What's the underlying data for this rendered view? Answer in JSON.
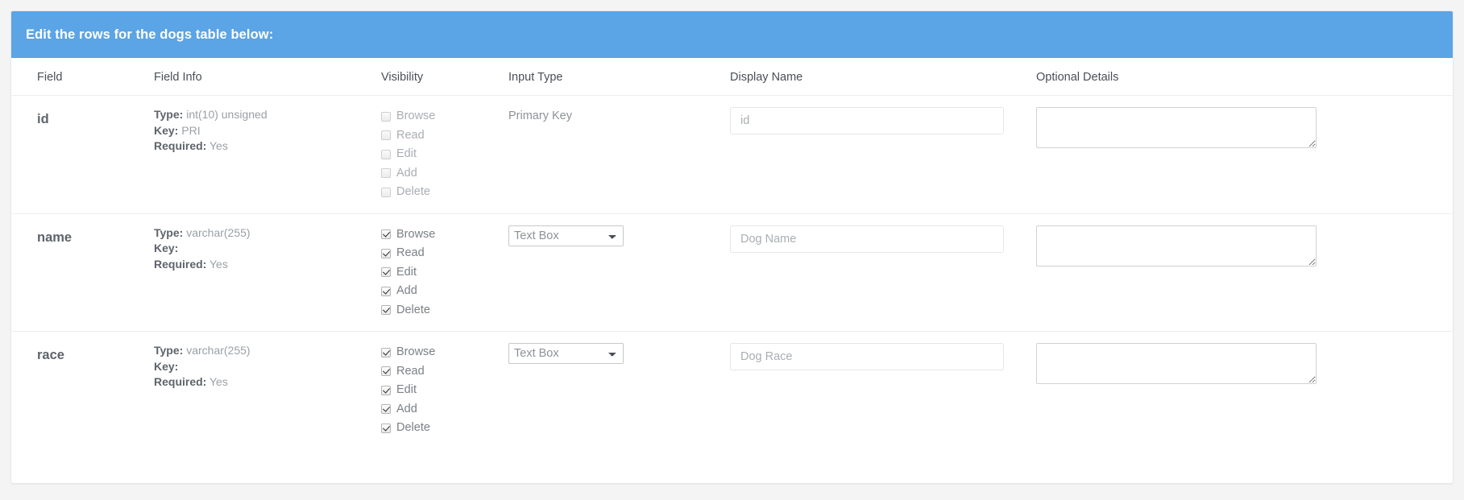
{
  "header": {
    "title": "Edit the rows for the dogs table below:",
    "accent_color": "#5ba4e5"
  },
  "table": {
    "columns": [
      {
        "key": "field",
        "label": "Field"
      },
      {
        "key": "field_info",
        "label": "Field Info"
      },
      {
        "key": "visibility",
        "label": "Visibility"
      },
      {
        "key": "input_type",
        "label": "Input Type"
      },
      {
        "key": "display_name",
        "label": "Display Name"
      },
      {
        "key": "optional_details",
        "label": "Optional Details"
      }
    ],
    "info_labels": {
      "type": "Type:",
      "key": "Key:",
      "required": "Required:"
    },
    "visibility_labels": {
      "browse": "Browse",
      "read": "Read",
      "edit": "Edit",
      "add": "Add",
      "delete": "Delete"
    },
    "rows": [
      {
        "field": "id",
        "type_value": "int(10) unsigned",
        "key_value": "PRI",
        "required_value": "Yes",
        "visibility": {
          "browse": false,
          "read": false,
          "edit": false,
          "add": false,
          "delete": false,
          "disabled": true
        },
        "input_type_is_select": false,
        "input_type_static": "Primary Key",
        "input_type_value": "",
        "display_name_value": "",
        "display_name_placeholder": "id",
        "optional_details_value": ""
      },
      {
        "field": "name",
        "type_value": "varchar(255)",
        "key_value": "",
        "required_value": "Yes",
        "visibility": {
          "browse": true,
          "read": true,
          "edit": true,
          "add": true,
          "delete": true,
          "disabled": false
        },
        "input_type_is_select": true,
        "input_type_static": "",
        "input_type_value": "Text Box",
        "display_name_value": "",
        "display_name_placeholder": "Dog Name",
        "optional_details_value": ""
      },
      {
        "field": "race",
        "type_value": "varchar(255)",
        "key_value": "",
        "required_value": "Yes",
        "visibility": {
          "browse": true,
          "read": true,
          "edit": true,
          "add": true,
          "delete": true,
          "disabled": false
        },
        "input_type_is_select": true,
        "input_type_static": "",
        "input_type_value": "Text Box",
        "display_name_value": "",
        "display_name_placeholder": "Dog Race",
        "optional_details_value": ""
      }
    ]
  }
}
